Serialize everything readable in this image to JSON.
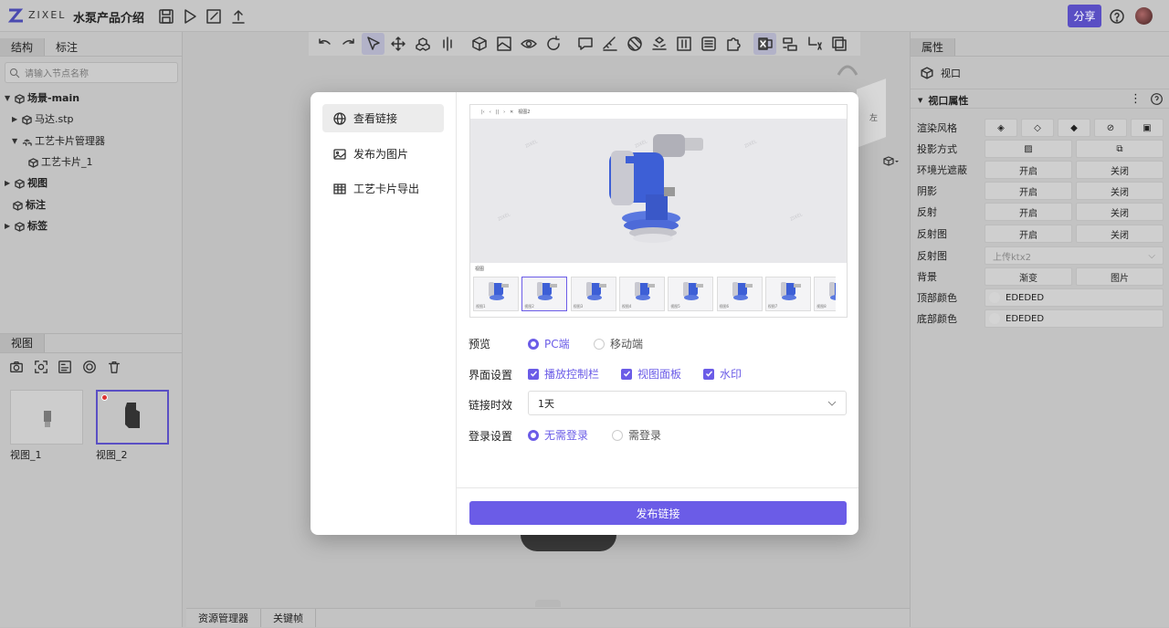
{
  "app": {
    "brand": "ZIXEL",
    "doc_title": "水泵产品介绍",
    "share_label": "分享",
    "accent": "#6b5ce7"
  },
  "left": {
    "tabs": [
      "结构",
      "标注"
    ],
    "search_placeholder": "请输入节点名称",
    "tree": [
      {
        "label": "场景-main",
        "bold": true
      },
      {
        "label": "马达.stp"
      },
      {
        "label": "工艺卡片管理器"
      },
      {
        "label": "工艺卡片_1"
      },
      {
        "label": "视图",
        "bold": true
      },
      {
        "label": "标注",
        "bold": true
      },
      {
        "label": "标签",
        "bold": true
      }
    ],
    "views_tab": "视图",
    "views": [
      {
        "label": "视图_1"
      },
      {
        "label": "视图_2"
      }
    ]
  },
  "bottom_tabs": [
    "资源管理器",
    "关键帧"
  ],
  "right": {
    "tab": "属性",
    "viewport_label": "视口",
    "section_title": "视口属性",
    "props": {
      "render_style": "渲染风格",
      "projection": "投影方式",
      "ao": "环境光遮蔽",
      "shadow": "阴影",
      "reflection": "反射",
      "reflection_map": "反射图",
      "reflection_map2": "反射图",
      "background": "背景",
      "top_color": "顶部颜色",
      "bottom_color": "底部颜色"
    },
    "on": "开启",
    "off": "关闭",
    "upload_placeholder": "上传ktx2",
    "gradient": "渐变",
    "image": "图片",
    "top_color_value": "EDEDED",
    "bottom_color_value": "EDEDED",
    "top_color_hex": "#EDEDED",
    "bottom_color_hex": "#EDEDED"
  },
  "modal": {
    "menu": [
      {
        "label": "查看链接",
        "icon": "globe-icon"
      },
      {
        "label": "发布为图片",
        "icon": "image-icon"
      },
      {
        "label": "工艺卡片导出",
        "icon": "table-icon"
      }
    ],
    "preview_label": "预览",
    "preview_options": [
      "PC端",
      "移动端"
    ],
    "ui_label": "界面设置",
    "ui_options": [
      "播放控制栏",
      "视图面板",
      "水印"
    ],
    "expiry_label": "链接时效",
    "expiry_value": "1天",
    "login_label": "登录设置",
    "login_options": [
      "无需登录",
      "需登录"
    ],
    "publish_button": "发布链接",
    "mini": {
      "view_title": "视图2",
      "views_header": "视图",
      "watermark": "ZIXEL",
      "thumbs": [
        "视图1",
        "视图2",
        "视图3",
        "视图4",
        "视图5",
        "视图6",
        "视图7",
        "视图8"
      ]
    }
  }
}
